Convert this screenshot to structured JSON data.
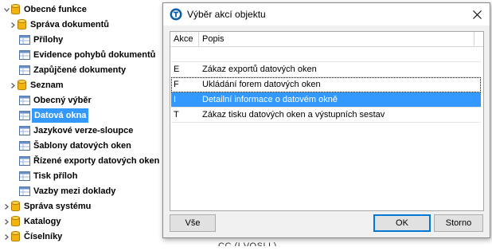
{
  "tree": {
    "items": [
      {
        "label": "Obecné funkce",
        "icon": "database-icon",
        "chevron": "down"
      },
      {
        "label": "Správa dokumentů",
        "icon": "database-icon",
        "chevron": "right"
      },
      {
        "label": "Přílohy",
        "icon": "table-icon",
        "chevron": ""
      },
      {
        "label": "Evidence pohybů dokumentů",
        "icon": "table-icon",
        "chevron": ""
      },
      {
        "label": "Zapůjčené dokumenty",
        "icon": "table-icon",
        "chevron": ""
      },
      {
        "label": "Seznam",
        "icon": "database-icon",
        "chevron": "right"
      },
      {
        "label": "Obecný výběr",
        "icon": "table-icon",
        "chevron": ""
      },
      {
        "label": "Datová okna",
        "icon": "table-icon",
        "chevron": "",
        "selected": true
      },
      {
        "label": "Jazykové verze-sloupce",
        "icon": "table-icon",
        "chevron": ""
      },
      {
        "label": "Šablony datových oken",
        "icon": "table-icon",
        "chevron": ""
      },
      {
        "label": "Řízené exporty datových oken",
        "icon": "table-icon",
        "chevron": ""
      },
      {
        "label": "Tisk příloh",
        "icon": "table-icon",
        "chevron": ""
      },
      {
        "label": "Vazby mezi doklady",
        "icon": "table-icon",
        "chevron": ""
      },
      {
        "label": "Správa systému",
        "icon": "database-icon",
        "chevron": "right"
      },
      {
        "label": "Katalogy",
        "icon": "database-icon",
        "chevron": "right"
      },
      {
        "label": "Číselníky",
        "icon": "database-icon",
        "chevron": "right"
      }
    ]
  },
  "dialog": {
    "title": "Výběr akcí objektu",
    "columns": {
      "akce": "Akce",
      "popis": "Popis"
    },
    "rows": [
      {
        "akce": "",
        "popis": ""
      },
      {
        "akce": "E",
        "popis": "Zákaz exportů datových oken"
      },
      {
        "akce": "F",
        "popis": "Ukládání forem datových oken"
      },
      {
        "akce": "I",
        "popis": "Detailní informace o datovém okně",
        "selected": true
      },
      {
        "akce": "T",
        "popis": "Zákaz tisku datových oken a výstupních sestav"
      }
    ],
    "buttons": {
      "all": "Vše",
      "ok": "OK",
      "cancel": "Storno"
    }
  },
  "background_text": "CC (I VOSLL)",
  "colors": {
    "selection": "#3399ff",
    "folder": "#f2b30c",
    "accent": "#0078d7"
  }
}
